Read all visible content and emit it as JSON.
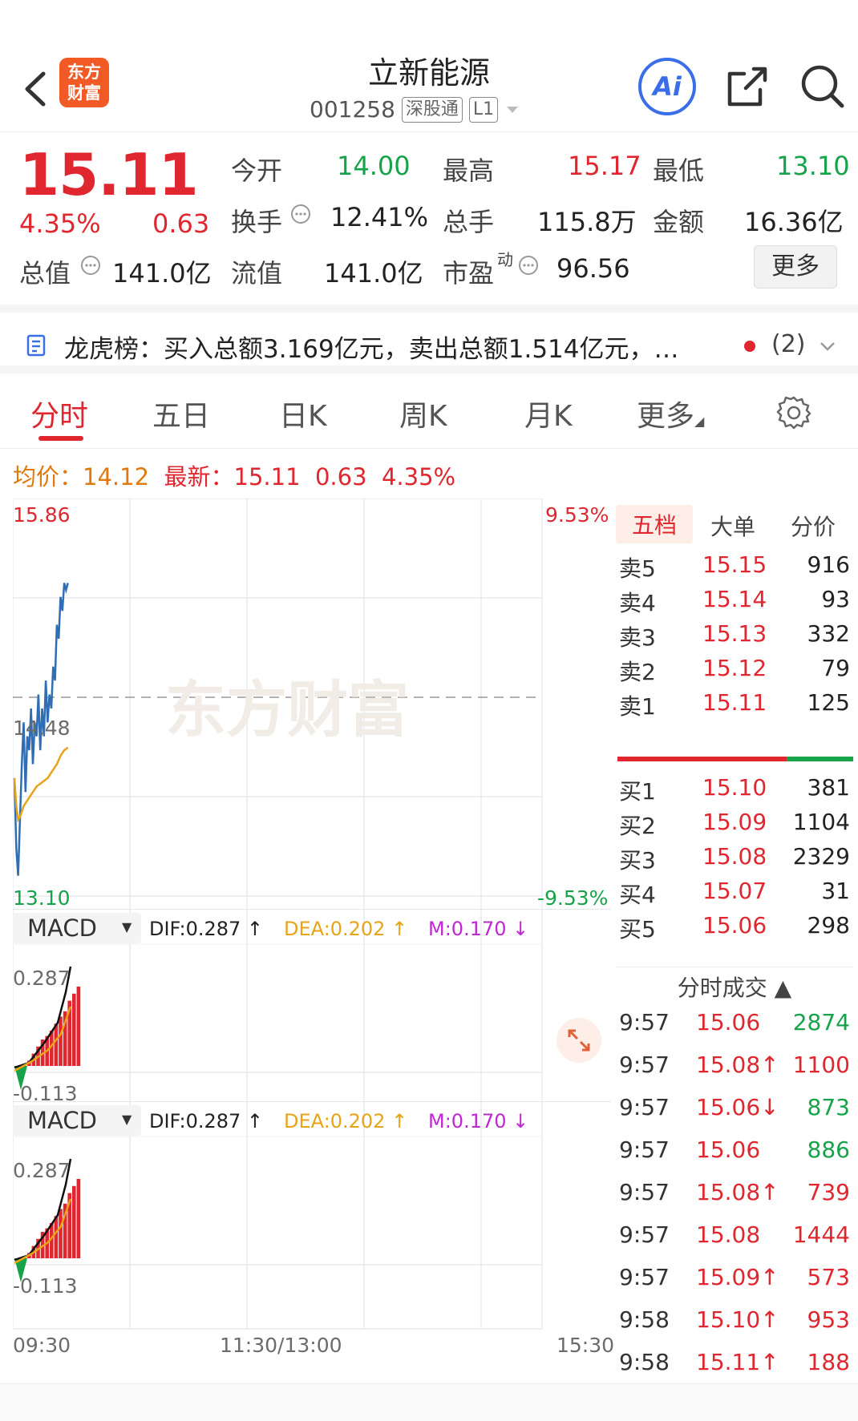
{
  "header": {
    "title": "立新能源",
    "code": "001258",
    "tag_connect": "深股通",
    "tag_level": "L1",
    "logo_text_1": "东方",
    "logo_text_2": "财富",
    "ai_label": "Ai"
  },
  "quote": {
    "price": "15.11",
    "pct": "4.35%",
    "change": "0.63",
    "fields": [
      {
        "label": "今开",
        "value": "14.00",
        "color": "green"
      },
      {
        "label": "最高",
        "value": "15.17",
        "color": "red"
      },
      {
        "label": "最低",
        "value": "13.10",
        "color": "green"
      },
      {
        "label": "换手",
        "value": "12.41%",
        "color": "dark"
      },
      {
        "label": "总手",
        "value": "115.8万",
        "color": "dark"
      },
      {
        "label": "金额",
        "value": "16.36亿",
        "color": "dark"
      },
      {
        "label": "总值",
        "value": "141.0亿",
        "color": "dark"
      },
      {
        "label": "流值",
        "value": "141.0亿",
        "color": "dark"
      },
      {
        "label": "市盈",
        "value": "96.56",
        "color": "dark"
      }
    ],
    "pe_sup": "动",
    "more_label": "更多"
  },
  "dragon": {
    "text": "龙虎榜：买入总额3.169亿元，卖出总额1.514亿元，…",
    "count": "(2)"
  },
  "tabs": [
    "分时",
    "五日",
    "日K",
    "周K",
    "月K",
    "更多"
  ],
  "avg_line": {
    "avg_label": "均价：",
    "avg_value": "14.12",
    "latest_label": "最新：",
    "latest_value": "15.11",
    "latest_change": "0.63",
    "latest_pct": "4.35%"
  },
  "chart_data": {
    "type": "line",
    "y_top": "15.86",
    "y_mid": "14.48",
    "y_bottom": "13.10",
    "pct_top": "9.53%",
    "pct_bottom": "-9.53%",
    "watermark": "东方财富",
    "x_labels": [
      "09:30",
      "11:30/13:00",
      "15:30"
    ],
    "price_series": [
      13.9,
      13.4,
      13.2,
      13.6,
      14.0,
      14.3,
      13.8,
      14.2,
      14.1,
      14.4,
      14.0,
      14.3,
      14.2,
      14.5,
      14.1,
      14.4,
      14.2,
      14.6,
      14.3,
      14.5,
      14.4,
      14.7,
      14.6,
      15.0,
      14.9,
      15.2,
      15.1,
      15.3,
      15.25,
      15.3
    ],
    "avg_series": [
      13.9,
      13.7,
      13.6,
      13.62,
      13.66,
      13.7,
      13.72,
      13.74,
      13.76,
      13.78,
      13.8,
      13.82,
      13.84,
      13.85,
      13.86,
      13.87,
      13.88,
      13.89,
      13.9,
      13.92,
      13.94,
      13.96,
      13.98,
      14.0,
      14.03,
      14.06,
      14.08,
      14.1,
      14.11,
      14.12
    ],
    "y_range": [
      13.1,
      15.86
    ]
  },
  "macd": [
    {
      "name": "MACD",
      "dif": "DIF:0.287 ↑",
      "dea": "DEA:0.202 ↑",
      "m": "M:0.170 ↓",
      "top": "0.287",
      "bottom": "-0.113"
    },
    {
      "name": "MACD",
      "dif": "DIF:0.287 ↑",
      "dea": "DEA:0.202 ↑",
      "m": "M:0.170 ↓",
      "top": "0.287",
      "bottom": "-0.113"
    }
  ],
  "book": {
    "tabs": [
      "五档",
      "大单",
      "分价"
    ],
    "asks": [
      {
        "label": "卖5",
        "price": "15.15",
        "vol": "916"
      },
      {
        "label": "卖4",
        "price": "15.14",
        "vol": "93"
      },
      {
        "label": "卖3",
        "price": "15.13",
        "vol": "332"
      },
      {
        "label": "卖2",
        "price": "15.12",
        "vol": "79"
      },
      {
        "label": "卖1",
        "price": "15.11",
        "vol": "125"
      }
    ],
    "bids": [
      {
        "label": "买1",
        "price": "15.10",
        "vol": "381"
      },
      {
        "label": "买2",
        "price": "15.09",
        "vol": "1104"
      },
      {
        "label": "买3",
        "price": "15.08",
        "vol": "2329"
      },
      {
        "label": "买4",
        "price": "15.07",
        "vol": "31"
      },
      {
        "label": "买5",
        "price": "15.06",
        "vol": "298"
      }
    ],
    "buy_ratio": 0.72
  },
  "ticks": {
    "title": "分时成交 ▲",
    "rows": [
      {
        "time": "9:57",
        "price": "15.06",
        "vol": "2874",
        "dir": "green"
      },
      {
        "time": "9:57",
        "price": "15.08↑",
        "vol": "1100",
        "dir": "red"
      },
      {
        "time": "9:57",
        "price": "15.06↓",
        "vol": "873",
        "dir": "green"
      },
      {
        "time": "9:57",
        "price": "15.06",
        "vol": "886",
        "dir": "green"
      },
      {
        "time": "9:57",
        "price": "15.08↑",
        "vol": "739",
        "dir": "red"
      },
      {
        "time": "9:57",
        "price": "15.08",
        "vol": "1444",
        "dir": "red"
      },
      {
        "time": "9:57",
        "price": "15.09↑",
        "vol": "573",
        "dir": "red"
      },
      {
        "time": "9:58",
        "price": "15.10↑",
        "vol": "953",
        "dir": "red"
      },
      {
        "time": "9:58",
        "price": "15.11↑",
        "vol": "188",
        "dir": "red"
      }
    ]
  },
  "colors": {
    "red": "#e0272f",
    "green": "#16a34a",
    "price_line": "#2f6db5",
    "avg_line": "#e8a317",
    "dea_color": "#e8a317",
    "m_color": "#c026d3"
  }
}
